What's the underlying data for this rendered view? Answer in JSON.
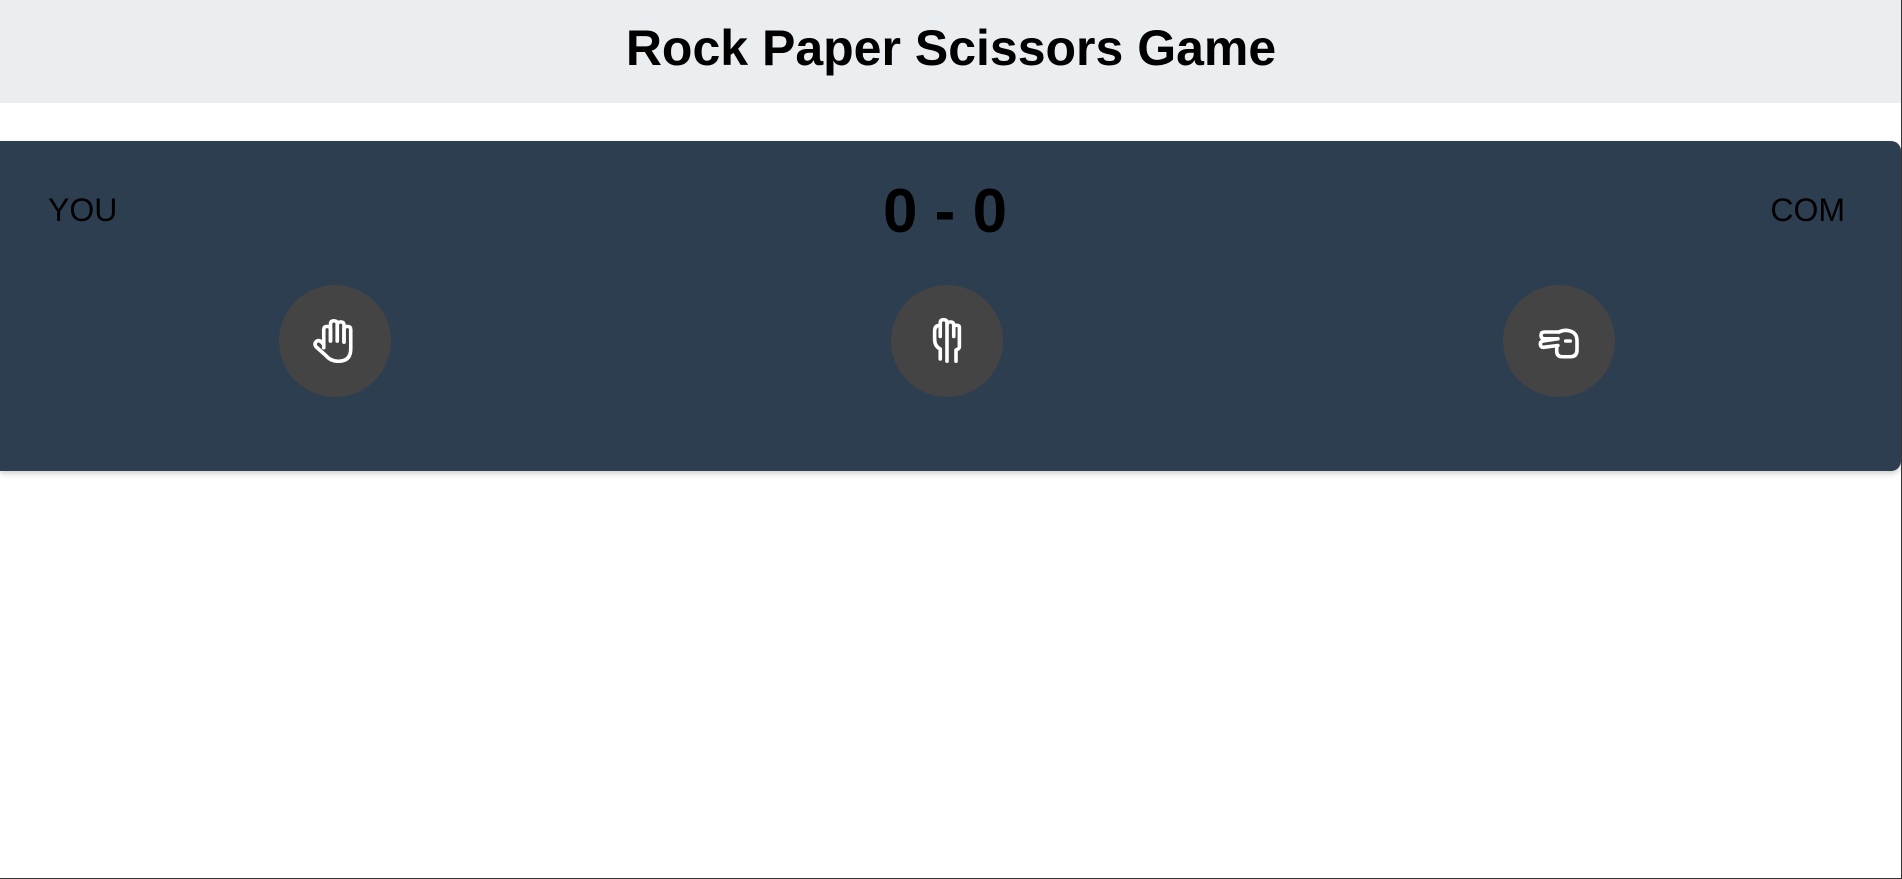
{
  "header": {
    "title": "Rock Paper Scissors Game"
  },
  "scoreboard": {
    "player_label": "YOU",
    "computer_label": "COM",
    "player_score": "0",
    "separator": "-",
    "computer_score": "0"
  },
  "choices": [
    {
      "name": "paper",
      "icon": "hand-paper-icon"
    },
    {
      "name": "rock",
      "icon": "hand-rock-icon"
    },
    {
      "name": "scissors",
      "icon": "hand-scissors-icon"
    }
  ],
  "colors": {
    "header_bg": "#ebeef0",
    "board_bg": "#2e3e51",
    "choice_button_bg": "#444444",
    "icon_color": "#ffffff",
    "text_color": "#000000"
  }
}
